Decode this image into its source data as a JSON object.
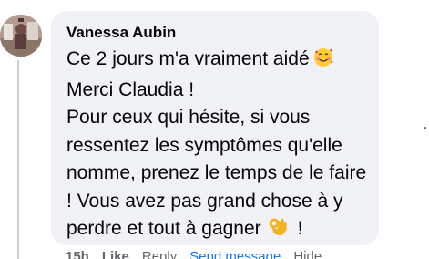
{
  "comment": {
    "author": "Vanessa Aubin",
    "lines": [
      "Ce 2 jours m'a vraiment aidé",
      "Merci Claudia !",
      "Pour ceux qui hésite, si vous",
      "ressentez les symptômes qu'elle",
      "nomme, prenez le temps de le faire",
      "! Vous avez pas grand chose à y",
      "perdre et tout à gagner",
      "!"
    ],
    "emojis": [
      "smiling-face-with-hearts-icon",
      "ok-hand-icon"
    ]
  },
  "actions": {
    "time": "15h",
    "like": "Like",
    "reply": "Reply",
    "send_message": "Send message",
    "hide": "Hide"
  },
  "colors": {
    "bubble": "#f0f2f5",
    "text": "#050505",
    "secondary": "#65676b",
    "link": "#1877f2"
  }
}
